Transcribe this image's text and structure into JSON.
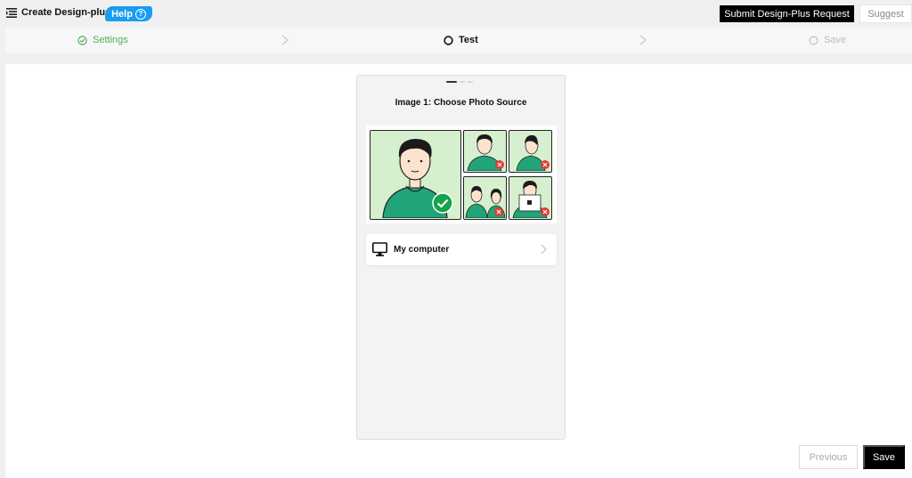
{
  "header": {
    "title": "Create Design-plus",
    "help_label": "Help",
    "help_icon": "question-circle-icon",
    "submit_label": "Submit Design-Plus Request",
    "suggest_label": "Suggest"
  },
  "stepper": {
    "steps": [
      {
        "label": "Settings",
        "state": "completed",
        "icon": "check-circle-icon"
      },
      {
        "label": "Test",
        "state": "active",
        "icon": "circle-icon"
      },
      {
        "label": "Save",
        "state": "pending",
        "icon": "circle-icon"
      }
    ]
  },
  "preview": {
    "title": "Image 1: Choose Photo Source",
    "page_dots": 3,
    "active_dot": 0,
    "source_option": {
      "label": "My computer",
      "icon": "monitor-icon"
    }
  },
  "footer": {
    "previous_label": "Previous",
    "save_label": "Save"
  },
  "colors": {
    "accent_green": "#4caf50",
    "help_blue": "#1a9cf0",
    "primary_black": "#000000",
    "shirt_green": "#21a47a",
    "error_red": "#e53935"
  }
}
